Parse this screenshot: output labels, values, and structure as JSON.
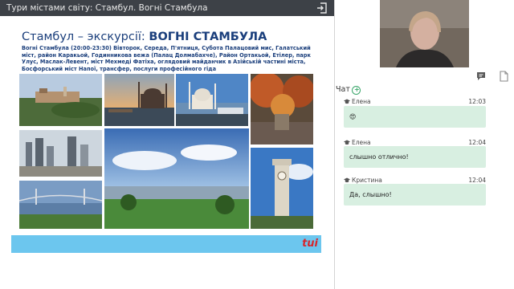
{
  "window": {
    "title": "Тури містами світу: Стамбул. Вогні Стамбула"
  },
  "slide": {
    "title_prefix": "Стамбул – экскурсії: ",
    "title_bold": "ВОГНІ СТАМБУЛА",
    "description": "Вогні Стамбула (20:00-23:30) Вівторок, Середа, П'ятниця, Субота Палацовий мис, Галатський міст, район Каракьой, Годинникова вежа (Палац Долмабахче), Район Ортакьой, Етілер, парк Улус, Маслак-Левент, міст Мехмеді Фатіха, оглядовий майданчик в Азійській частині міста, Босфорський міст Напої, трансфер, послуги професійного гіда",
    "logo": "tui",
    "accent_color": "#6cc6ee",
    "title_color": "#1b3f7c"
  },
  "chat": {
    "header": "Чат",
    "add_symbol": "+",
    "messages": [
      {
        "name": "Елена",
        "time": "12:03",
        "text": "😍"
      },
      {
        "name": "Елена",
        "time": "12:04",
        "text": "слышно отлично!"
      },
      {
        "name": "Кристина",
        "time": "12:04",
        "text": "Да, слышно!"
      }
    ],
    "bubble_color": "#d8efe1"
  },
  "icons": {
    "exit": "exit-icon",
    "chat": "chat-icon",
    "document": "document-icon",
    "graduation": "graduation-cap-icon"
  }
}
